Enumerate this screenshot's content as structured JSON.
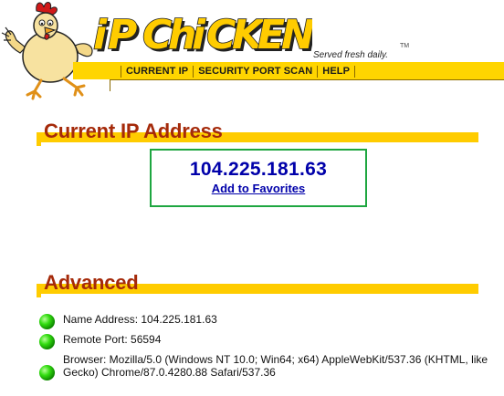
{
  "brand": {
    "title_letters": [
      "i",
      "P",
      "C",
      "h",
      "i",
      "C",
      "K",
      "E",
      "N"
    ],
    "tagline": "Served fresh daily.",
    "trademark": "TM"
  },
  "nav": {
    "items": [
      {
        "label": "CURRENT IP"
      },
      {
        "label": "SECURITY PORT SCAN"
      },
      {
        "label": "HELP"
      }
    ]
  },
  "current_ip": {
    "heading": "Current IP Address",
    "ip": "104.225.181.63",
    "favorites_link": "Add to Favorites"
  },
  "advanced": {
    "heading": "Advanced",
    "items": [
      {
        "text": "Name Address: 104.225.181.63"
      },
      {
        "text": "Remote Port: 56594"
      },
      {
        "text": "Browser: Mozilla/5.0 (Windows NT 10.0; Win64; x64) AppleWebKit/537.36 (KHTML, like Gecko) Chrome/87.0.4280.88 Safari/537.36"
      }
    ]
  },
  "colors": {
    "accent_yellow": "#ffcc00",
    "heading_red": "#a52a0a",
    "link_blue": "#0000aa",
    "box_green": "#1ea640",
    "status_green": "#22cc00"
  }
}
